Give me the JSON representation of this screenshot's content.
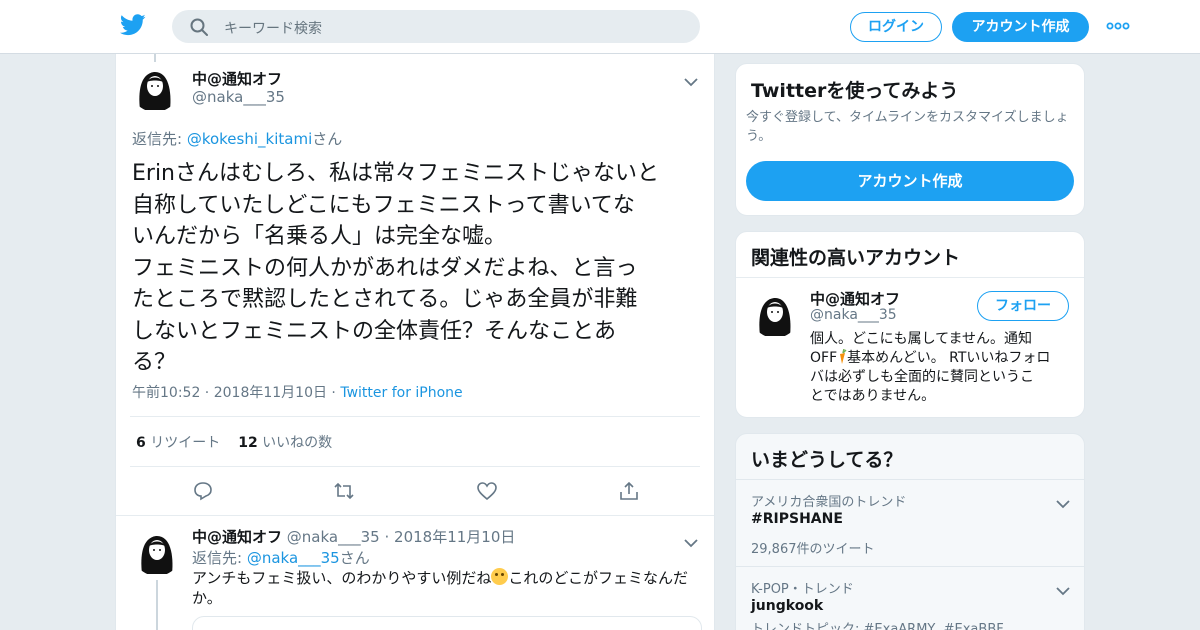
{
  "header": {
    "search_placeholder": "キーワード検索",
    "login_label": "ログイン",
    "signup_label": "アカウント作成"
  },
  "tweet": {
    "author_name": "中@通知オフ",
    "author_handle": "@naka___35",
    "reply_prefix": "返信先: ",
    "reply_handle": "@kokeshi_kitami",
    "reply_suffix": "さん",
    "text_lines": [
      "Erinさんはむしろ、私は常々フェミニストじゃないと",
      "自称していたしどこにもフェミニストって書いてな",
      "いんだから「名乗る人」は完全な嘘。",
      "フェミニストの何人かがあれはダメだよね、と言っ",
      "たところで黙認したとされてる。じゃあ全員が非難",
      "しないとフェミニストの全体責任？そんなことあ",
      "る？"
    ],
    "time": "午前10:52",
    "date": "2018年11月10日",
    "via": "Twitter for iPhone",
    "retweet_count": "6",
    "retweet_label": "リツイート",
    "like_count": "12",
    "like_label": "いいねの数"
  },
  "reply": {
    "author_name": "中@通知オフ",
    "author_handle": "@naka___35",
    "date": "2018年11月10日",
    "reply_prefix": "返信先: ",
    "reply_handle": "@naka___35",
    "reply_suffix": "さん",
    "text_before_emoji": "アンチもフェミ扱い、のわかりやすい例だね",
    "emoji": "thinking-face-emoji",
    "text_after_emoji": "これのどこがフェミなんだ",
    "text_line2": "か。"
  },
  "join_card": {
    "title": "Twitterを使ってみよう",
    "description": "今すぐ登録して、タイムラインをカスタマイズしましょう。",
    "button_label": "アカウント作成"
  },
  "related": {
    "title": "関連性の高いアカウント",
    "name": "中@通知オフ",
    "handle": "@naka___35",
    "follow_label": "フォロー",
    "bio_line1": "個人。どこにも属してません。通知",
    "bio_line2_pre": "OFF",
    "bio_emoji": "carrot-emoji",
    "bio_line2_post": "基本めんどい。 RTいいねフォロ",
    "bio_line3": "バは必ずしも全面的に賛同というこ",
    "bio_line4": "とではありません。"
  },
  "trends": {
    "title": "いまどうしてる？",
    "items": [
      {
        "context": "アメリカ合衆国のトレンド",
        "name": "#RIPSHANE",
        "count": "29,867件のツイート"
      },
      {
        "context": "K-POP・トレンド",
        "name": "jungkook",
        "topics_label": "トレンドトピック: ",
        "topics": "#ExaARMY, #ExaBBF"
      }
    ]
  },
  "colors": {
    "brand_blue": "#1da1f2",
    "link_blue": "#1b95e0",
    "background": "#e6ecf0",
    "text_secondary": "#657786"
  }
}
